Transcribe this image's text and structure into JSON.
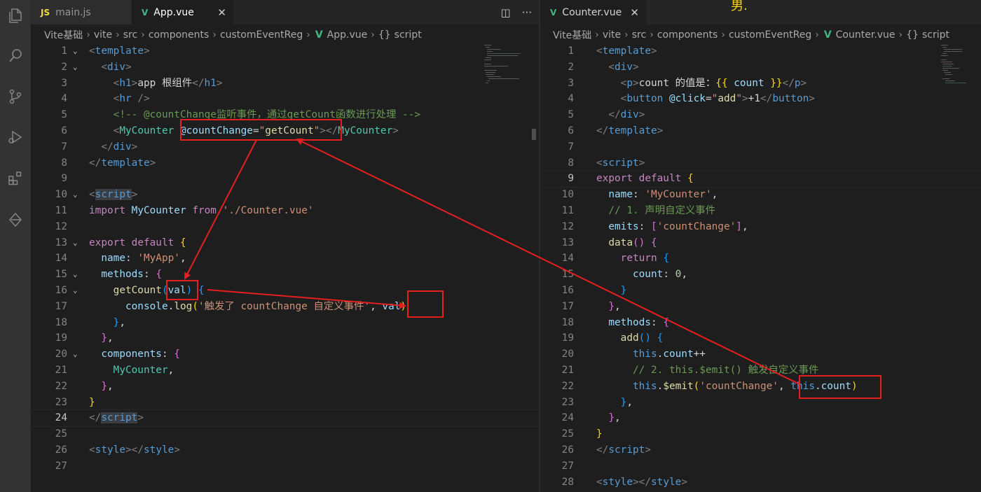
{
  "left": {
    "tabs": [
      {
        "icon": "JS",
        "label": "main.js"
      },
      {
        "icon": "V",
        "label": "App.vue",
        "close": "✕"
      }
    ],
    "breadcrumb": [
      "Vite基础",
      "vite",
      "src",
      "components",
      "customEventReg",
      "App.vue",
      "script"
    ],
    "actions": {
      "split": "◫",
      "more": "···"
    }
  },
  "right": {
    "tabs": [
      {
        "icon": "V",
        "label": "Counter.vue",
        "close": "✕"
      }
    ],
    "breadcrumb": [
      "Vite基础",
      "vite",
      "src",
      "components",
      "customEventReg",
      "Counter.vue",
      "script"
    ],
    "extra": "男."
  },
  "icons": {
    "explorer": "files-icon",
    "search": "search-icon",
    "source_control": "source-control-icon",
    "run": "run-debug-icon",
    "extensions": "extensions-icon",
    "remote": "remote-icon",
    "vue": "vue-icon",
    "braces": "{}"
  },
  "colors": {
    "accent_red": "#e51f1f",
    "vue_green": "#41b883",
    "js_yellow": "#f1dd3f"
  }
}
